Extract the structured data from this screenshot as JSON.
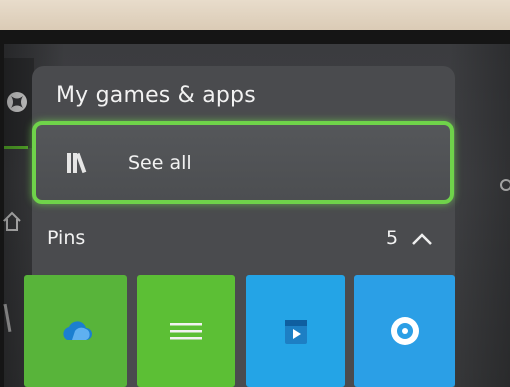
{
  "guide": {
    "title": "My games & apps",
    "see_all": {
      "label": "See all",
      "icon": "library-icon"
    },
    "pins": {
      "label": "Pins",
      "count": "5",
      "tiles": [
        {
          "name": "onedrive",
          "icon": "cloud-icon",
          "color": "#58b43a"
        },
        {
          "name": "menu",
          "icon": "lines-icon",
          "color": "#5cbf35"
        },
        {
          "name": "movies-tv",
          "icon": "film-icon",
          "color": "#24a4e6"
        },
        {
          "name": "groove",
          "icon": "disc-icon",
          "color": "#2b9fe6"
        }
      ]
    }
  },
  "colors": {
    "focus": "#6fd34a",
    "panel": "#4a4b4e"
  }
}
